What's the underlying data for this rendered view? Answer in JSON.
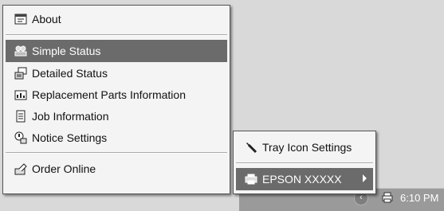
{
  "main_menu": {
    "items": [
      {
        "label": "About",
        "icon": "about-window-icon"
      },
      {
        "label": "Simple Status",
        "icon": "status-people-icon",
        "selected": true
      },
      {
        "label": "Detailed Status",
        "icon": "status-detail-icon"
      },
      {
        "label": "Replacement Parts Information",
        "icon": "parts-icon"
      },
      {
        "label": "Job Information",
        "icon": "job-document-icon"
      },
      {
        "label": "Notice Settings",
        "icon": "notice-icon"
      },
      {
        "label": "Order Online",
        "icon": "order-online-icon"
      }
    ]
  },
  "sub_menu": {
    "items": [
      {
        "label": "Tray Icon Settings",
        "icon": "wrench-icon"
      },
      {
        "label": "EPSON XXXXX",
        "icon": "printer-icon",
        "selected": true
      }
    ]
  },
  "taskbar": {
    "clock": "6:10 PM",
    "chevron": "‹"
  }
}
